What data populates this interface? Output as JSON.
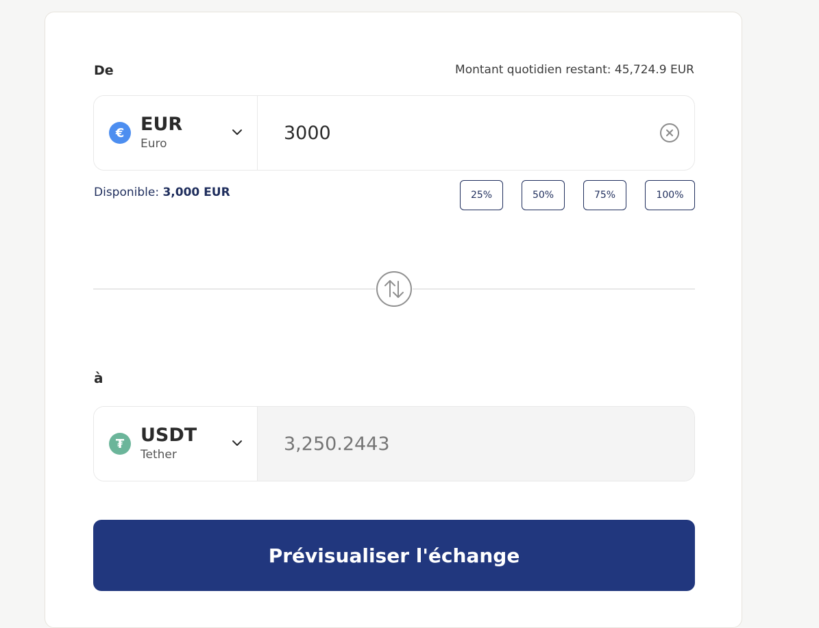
{
  "from": {
    "label": "De",
    "daily_remaining": "Montant quotidien restant: 45,724.9 EUR",
    "currency": {
      "icon": "euro-icon",
      "symbol": "€",
      "code": "EUR",
      "name": "Euro",
      "color": "#4d8ef0"
    },
    "amount": "3000",
    "available_label": "Disponible:",
    "available_value": "3,000 EUR",
    "percent_buttons": [
      "25%",
      "50%",
      "75%",
      "100%"
    ]
  },
  "to": {
    "label": "à",
    "currency": {
      "icon": "tether-icon",
      "symbol": "₮",
      "code": "USDT",
      "name": "Tether",
      "color": "#6bb59a"
    },
    "amount_placeholder": "3,250.2443"
  },
  "preview_button": "Prévisualiser l'échange",
  "colors": {
    "primary": "#21377e",
    "text_dark": "#2a2a2a",
    "link_blue": "#1e2d5c"
  }
}
